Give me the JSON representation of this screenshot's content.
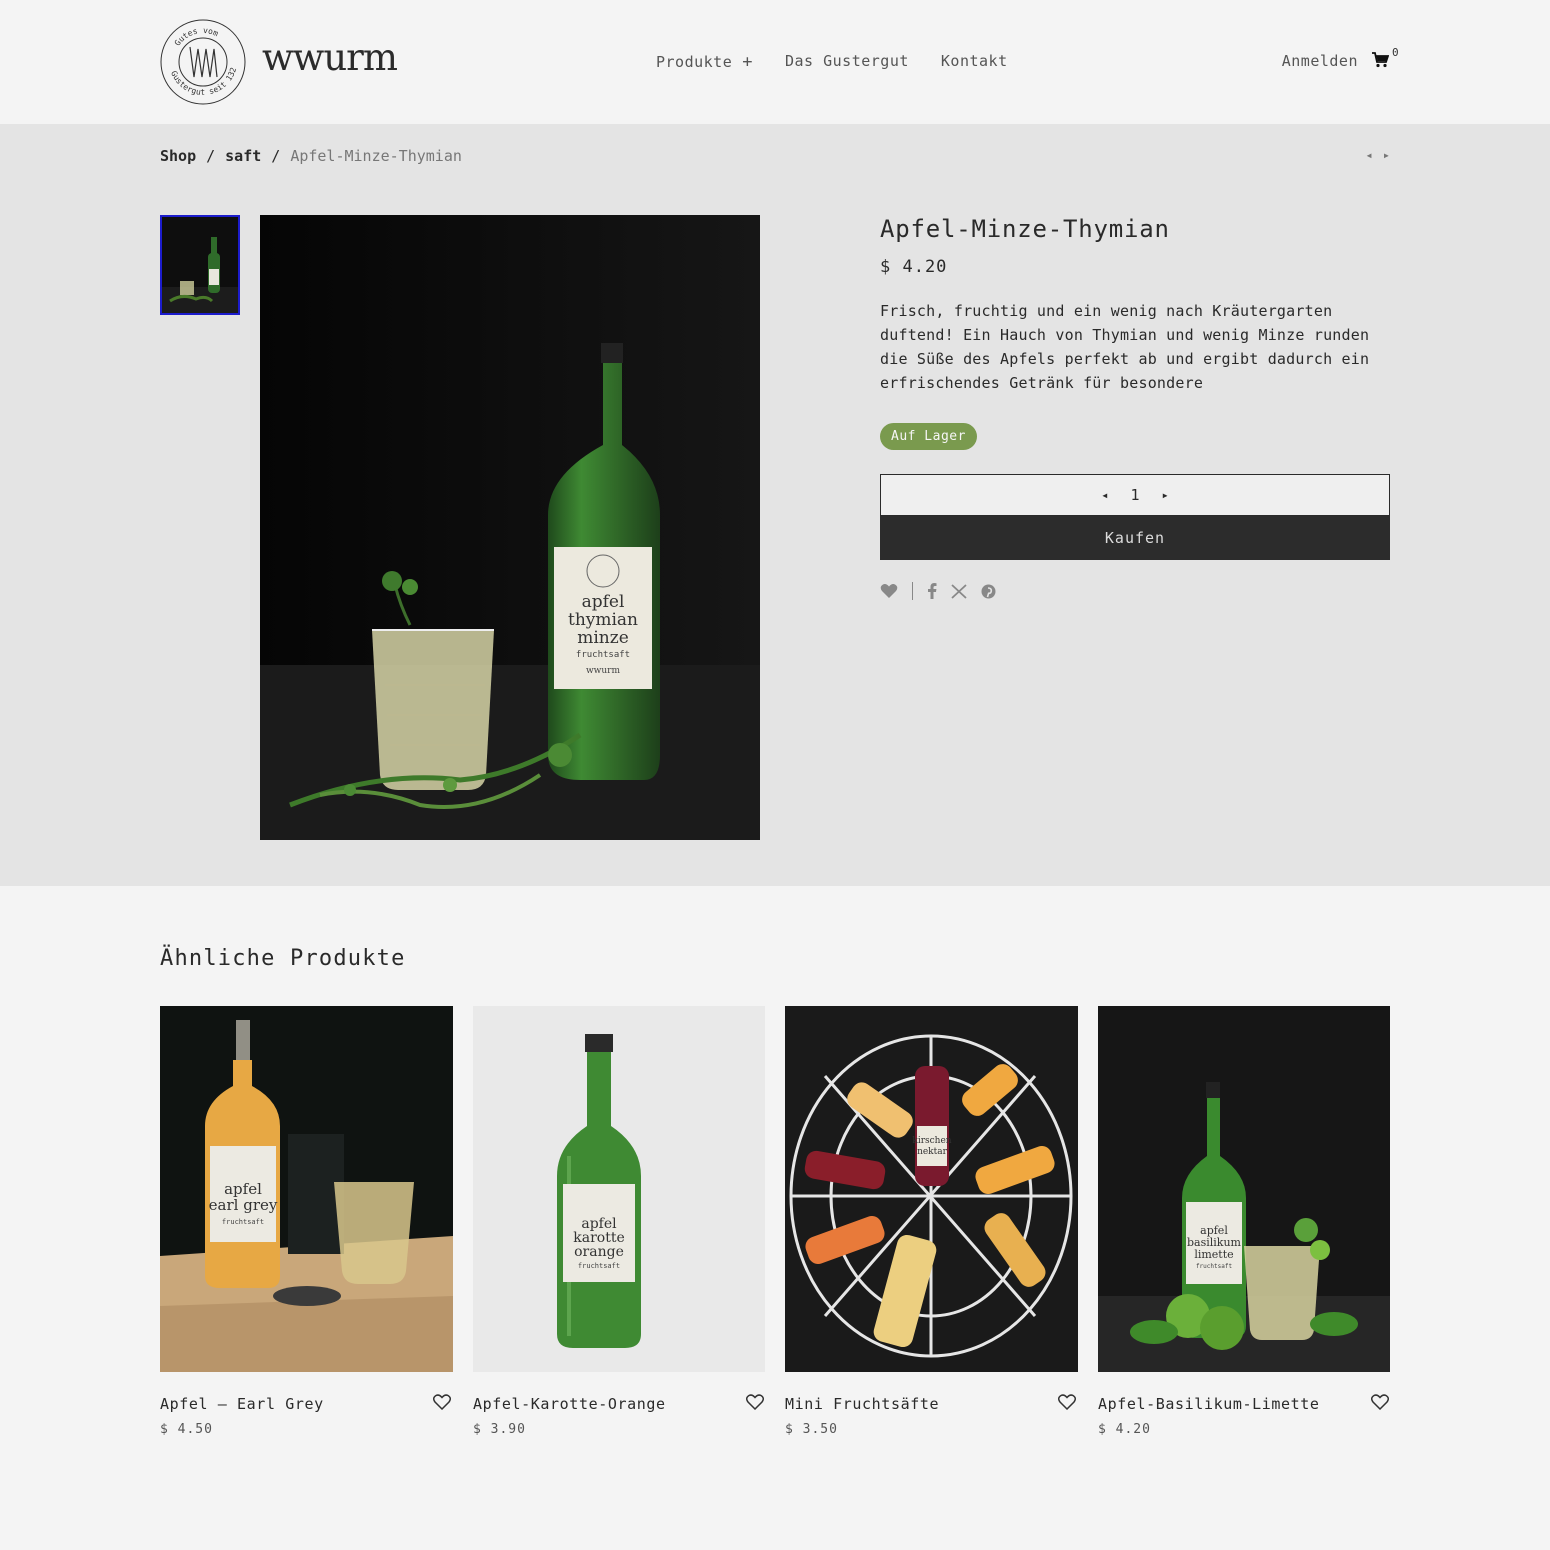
{
  "brand": {
    "name": "wwurm",
    "seal_text_top": "Gutes vom",
    "seal_text_bottom": "Gustergut seit 1324"
  },
  "nav": {
    "items": [
      {
        "label": "Produkte",
        "expand": "+"
      },
      {
        "label": "Das Gustergut"
      },
      {
        "label": "Kontakt"
      }
    ]
  },
  "account": {
    "login": "Anmelden",
    "cart_count": "0"
  },
  "breadcrumb": {
    "items": [
      "Shop",
      "saft",
      "Apfel-Minze-Thymian"
    ],
    "separator": "/"
  },
  "product_nav": {
    "prev": "◂",
    "next": "▸"
  },
  "product": {
    "title": "Apfel-Minze-Thymian",
    "price": "$ 4.20",
    "description": "Frisch, fruchtig und ein wenig nach Kräutergarten duftend! Ein Hauch von Thymian und wenig Minze runden die Süße des Apfels perfekt ab und ergibt dadurch ein erfrischendes Getränk für besondere",
    "stock": "Auf Lager",
    "quantity": "1",
    "qty_minus": "◂",
    "qty_plus": "▸",
    "buy_label": "Kaufen",
    "label_lines": [
      "apfel",
      "thymian",
      "minze",
      "fruchtsaft",
      "wwurm"
    ]
  },
  "social": {
    "icons": [
      "heart-icon",
      "facebook-icon",
      "x-icon",
      "pinterest-icon"
    ]
  },
  "related": {
    "title": "Ähnliche Produkte",
    "items": [
      {
        "name": "Apfel — Earl Grey",
        "price": "$ 4.50",
        "label": [
          "apfel",
          "earl grey",
          "fruchtsaft"
        ]
      },
      {
        "name": "Apfel-Karotte-Orange",
        "price": "$ 3.90",
        "label": [
          "apfel",
          "karotte",
          "orange",
          "fruchtsaft"
        ]
      },
      {
        "name": "Mini Fruchtsäfte",
        "price": "$ 3.50",
        "label": [
          "kirschen",
          "nektar"
        ]
      },
      {
        "name": "Apfel-Basilikum-Limette",
        "price": "$ 4.20",
        "label": [
          "apfel",
          "basilikum",
          "limette",
          "fruchtsaft"
        ]
      }
    ]
  },
  "colors": {
    "accent_green": "#7a9a4e",
    "buy_button": "#2c2c2c",
    "thumb_border": "#1c1ccc"
  }
}
